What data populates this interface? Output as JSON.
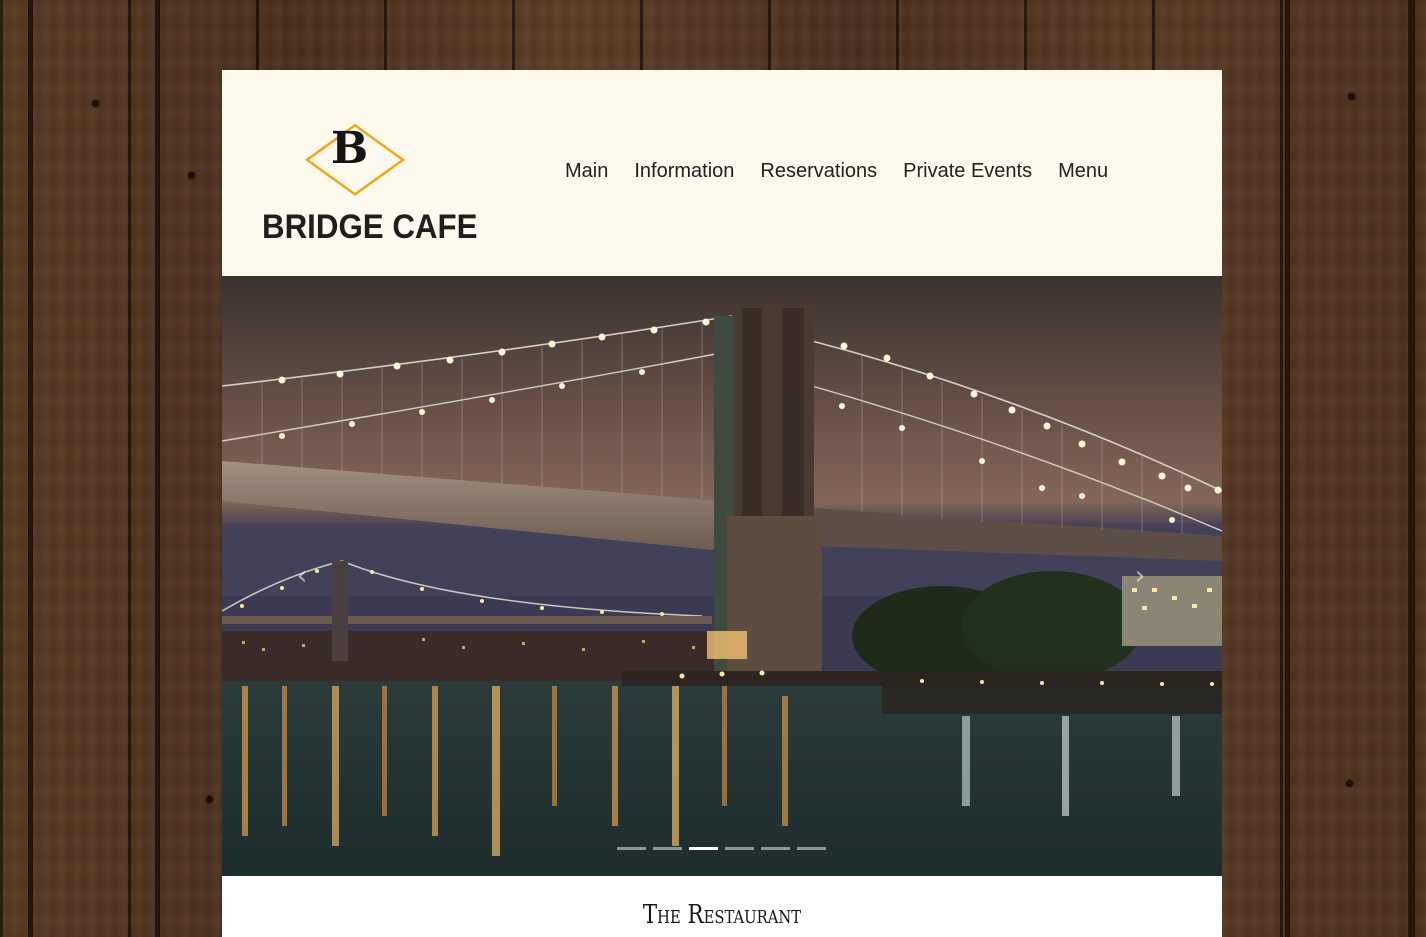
{
  "brand": {
    "logo_letter": "B",
    "name": "BRIDGE CAFE",
    "accent_color": "#f0a51c"
  },
  "nav": {
    "items": [
      {
        "label": "Main"
      },
      {
        "label": "Information"
      },
      {
        "label": "Reservations"
      },
      {
        "label": "Private Events"
      },
      {
        "label": "Menu"
      }
    ]
  },
  "slider": {
    "prev_icon": "chevron-left-icon",
    "next_icon": "chevron-right-icon",
    "prev_glyph": "‹",
    "next_glyph": "›",
    "slide_count": 6,
    "active_index": 2
  },
  "content": {
    "section_title": "The Restaurant"
  }
}
